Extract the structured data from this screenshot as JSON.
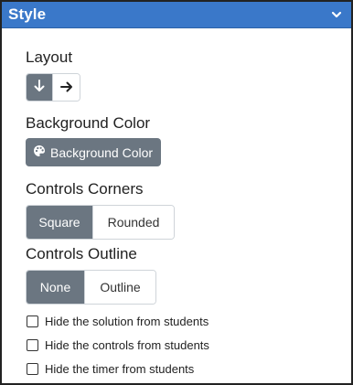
{
  "panel": {
    "title": "Style",
    "collapse_icon": "chevron-down-icon"
  },
  "layout": {
    "label": "Layout",
    "options": [
      {
        "icon": "arrow-down-icon",
        "active": true
      },
      {
        "icon": "arrow-right-icon",
        "active": false
      }
    ]
  },
  "background": {
    "label": "Background Color",
    "button_label": "Background Color",
    "button_icon": "palette-icon"
  },
  "corners": {
    "label": "Controls Corners",
    "options": [
      {
        "label": "Square",
        "active": true
      },
      {
        "label": "Rounded",
        "active": false
      }
    ]
  },
  "outline": {
    "label": "Controls Outline",
    "options": [
      {
        "label": "None",
        "active": true
      },
      {
        "label": "Outline",
        "active": false
      }
    ]
  },
  "checkboxes": [
    {
      "label": "Hide the solution from students",
      "checked": false
    },
    {
      "label": "Hide the controls from students",
      "checked": false
    },
    {
      "label": "Hide the timer from students",
      "checked": false
    }
  ],
  "colors": {
    "header": "#3a78c9",
    "active_button": "#6b7681",
    "border": "#cfd4d9"
  }
}
